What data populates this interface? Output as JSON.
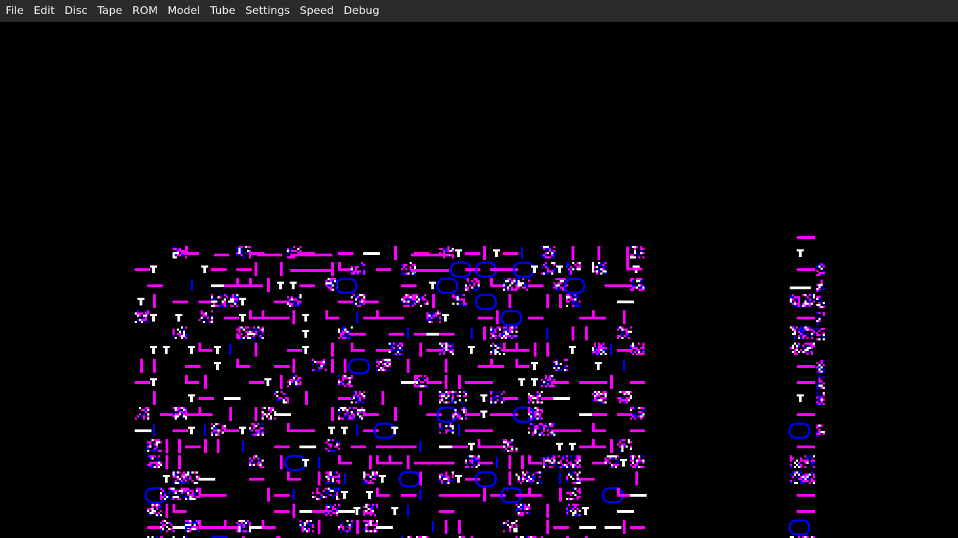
{
  "menubar": {
    "items": [
      {
        "id": "file",
        "label": "File"
      },
      {
        "id": "edit",
        "label": "Edit"
      },
      {
        "id": "disc",
        "label": "Disc"
      },
      {
        "id": "tape",
        "label": "Tape"
      },
      {
        "id": "rom",
        "label": "ROM"
      },
      {
        "id": "model",
        "label": "Model"
      },
      {
        "id": "tube",
        "label": "Tube"
      },
      {
        "id": "settings",
        "label": "Settings"
      },
      {
        "id": "speed",
        "label": "Speed"
      },
      {
        "id": "debug",
        "label": "Debug"
      }
    ]
  },
  "emulator_screen": {
    "palette": {
      "background": "#000000",
      "magenta": "#ff00ff",
      "white": "#ffffff",
      "blue": "#0000ff"
    },
    "content": "garbled-graphics-mode-7-style"
  }
}
